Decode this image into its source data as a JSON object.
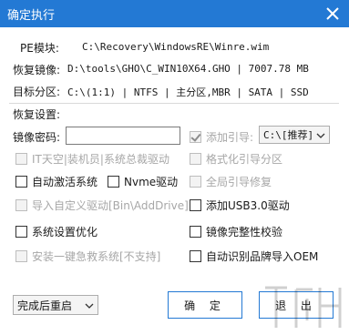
{
  "window": {
    "title": "确定执行"
  },
  "info": {
    "pe_label": "PE模块:",
    "pe_value": "C:\\Recovery\\WindowsRE\\Winre.wim",
    "restore_label": "恢复镜像:",
    "restore_value": "D:\\tools\\GHO\\C_WIN10X64.GHO | 7007.78 MB",
    "target_label": "目标分区:",
    "target_value": "C:\\(1:1) | NTFS | 主分区,MBR | SATA | SSD"
  },
  "settings": {
    "heading": "恢复设置:",
    "password_label": "镜像密码:",
    "password_value": "",
    "add_boot": {
      "label": "添加引导:",
      "checked": true,
      "enabled": false
    },
    "boot_select": {
      "value": "C:\\[推荐]"
    },
    "options": [
      {
        "label": "IT天空|装机员|系统总裁驱动",
        "checked": false,
        "enabled": false
      },
      {
        "label": "格式化引导分区",
        "checked": false,
        "enabled": false
      },
      {
        "label": "自动激活系统",
        "checked": false,
        "enabled": true
      },
      {
        "label": "Nvme驱动",
        "checked": false,
        "enabled": true
      },
      {
        "label": "全局引导修复",
        "checked": false,
        "enabled": false
      },
      {
        "label": "导入自定义驱动[Bin\\AddDrive]",
        "checked": false,
        "enabled": false
      },
      {
        "label": "添加USB3.0驱动",
        "checked": false,
        "enabled": true
      },
      {
        "label": "系统设置优化",
        "checked": false,
        "enabled": true
      },
      {
        "label": "镜像完整性校验",
        "checked": false,
        "enabled": true
      },
      {
        "label": "安装一键急救系统[不支持]",
        "checked": false,
        "enabled": false
      },
      {
        "label": "自动识别品牌导入OEM",
        "checked": false,
        "enabled": true
      }
    ]
  },
  "footer": {
    "after_select": {
      "value": "完成后重启"
    },
    "ok_label": "确 定",
    "exit_label": "退 出"
  },
  "icons": {
    "close": "close-icon",
    "dropdown": "chevron-down-icon"
  },
  "colors": {
    "titlebar": "#2379d4",
    "accent": "#2379d4"
  }
}
